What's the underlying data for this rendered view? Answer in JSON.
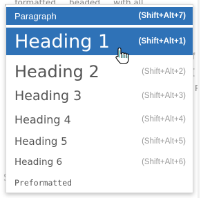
{
  "background": {
    "top_line": "... formatted ... headed ... with all",
    "right_fragment_1": "f",
    "right_fragment_2": "[",
    "right_fragment_3": "P",
    "bottom_fragment": "S"
  },
  "menu": {
    "items": [
      {
        "label": "Paragraph",
        "shortcut": "(Shift+Alt+7)",
        "state": "highlighted"
      },
      {
        "label": "Heading 1",
        "shortcut": "(Shift+Alt+1)",
        "state": "hovered"
      },
      {
        "label": "Heading 2",
        "shortcut": "(Shift+Alt+2)",
        "state": "normal"
      },
      {
        "label": "Heading 3",
        "shortcut": "(Shift+Alt+3)",
        "state": "normal"
      },
      {
        "label": "Heading 4",
        "shortcut": "(Shift+Alt+4)",
        "state": "normal"
      },
      {
        "label": "Heading 5",
        "shortcut": "(Shift+Alt+5)",
        "state": "normal"
      },
      {
        "label": "Heading 6",
        "shortcut": "(Shift+Alt+6)",
        "state": "normal"
      },
      {
        "label": "Preformatted",
        "shortcut": "",
        "state": "normal"
      }
    ]
  },
  "colors": {
    "accent": "#2f72b7",
    "text": "#555555",
    "shortcut": "#9a9a9a"
  },
  "cursor": {
    "icon": "hand-pointer-icon"
  }
}
